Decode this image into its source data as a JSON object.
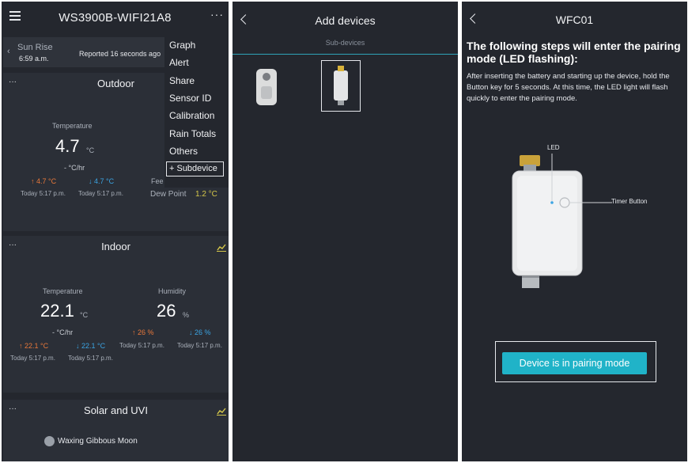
{
  "panel1": {
    "title": "WS3900B-WIFI21A8",
    "more": "···",
    "sunrise": {
      "label": "Sun Rise",
      "time": "6:59 a.m.",
      "reported": "Reported 16 seconds ago"
    },
    "menu": [
      "Graph",
      "Alert",
      "Share",
      "Sensor ID",
      "Calibration",
      "Rain Totals",
      "Others"
    ],
    "menu_subdevice": "+ Subdevice",
    "outdoor": {
      "title": "Outdoor",
      "dots": "···",
      "temp_label": "Temperature",
      "temp_value": "4.7",
      "temp_unit": "°C",
      "rate": "- °C/hr",
      "high": "↑ 4.7 °C",
      "low": "↓ 4.7 °C",
      "high_time": "Today 5:17 p.m.",
      "low_time": "Today 5:17 p.m.",
      "feels_prefix": "Fee",
      "dew_label": "Dew Point",
      "dew_value": "1.2 °C"
    },
    "indoor": {
      "title": "Indoor",
      "dots": "···",
      "temp_label": "Temperature",
      "temp_value": "22.1",
      "temp_unit": "°C",
      "rate": "- °C/hr",
      "temp_high": "↑ 22.1 °C",
      "temp_low": "↓ 22.1 °C",
      "temp_high_time": "Today 5:17 p.m.",
      "temp_low_time": "Today 5:17 p.m.",
      "hum_label": "Humidity",
      "hum_value": "26",
      "hum_unit": "%",
      "hum_high": "↑ 26 %",
      "hum_low": "↓ 26 %",
      "hum_high_time": "Today 5:17 p.m.",
      "hum_low_time": "Today 5:17 p.m."
    },
    "solar": {
      "title": "Solar and UVI",
      "dots": "···",
      "moon": "Waxing Gibbous Moon"
    },
    "colors": {
      "high": "#e8783a",
      "low": "#3ba4e3",
      "dew": "#d6c84a",
      "chart_icon": "#d6c84a"
    }
  },
  "panel2": {
    "title": "Add devices",
    "subtitle": "Sub-devices",
    "devices": [
      "plug-device",
      "valve-device"
    ]
  },
  "panel3": {
    "title": "WFC01",
    "heading": "The following steps will enter the pairing mode (LED flashing):",
    "description": "After inserting the battery and starting up the device, hold the Button key for 5 seconds. At this time, the LED light will flash quickly to enter the pairing mode.",
    "led_label": "LED",
    "timer_label": "Timer Button",
    "button": "Device is in pairing mode",
    "accent": "#20b3c8"
  }
}
